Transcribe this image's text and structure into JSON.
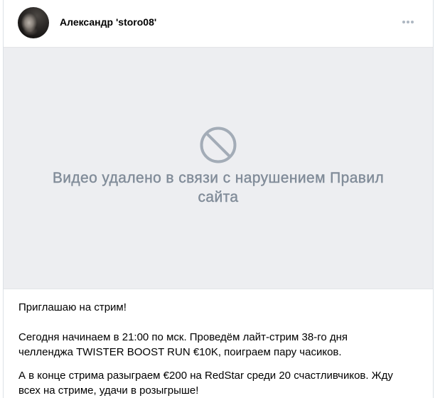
{
  "post": {
    "author": {
      "name": "Александр 'storo08'"
    },
    "menu_icon": "more-horizontal-icon",
    "video": {
      "status_icon": "blocked-icon",
      "message": "Видео удалено в связи с нарушением Правил сайта"
    },
    "text": {
      "paragraphs": [
        {
          "lines": [
            "Приглашаю на стрим!"
          ]
        },
        {
          "lines": [
            "Сегодня начинаем в 21:00 по мск. Проведём лайт-стрим 38-го дня",
            "челленджа TWISTER BOOST RUN €10K, поиграем пару часиков."
          ]
        },
        {
          "lines": [
            "А в конце стрима разыграем €200 на RedStar среди 20 счастливчиков. Жду",
            "всех на стриме, удачи в розыгрыше!"
          ]
        }
      ]
    }
  },
  "colors": {
    "card_border": "#dce1e6",
    "placeholder_background": "#edeef1",
    "placeholder_divider": "#e3e5e8",
    "placeholder_icon": "#a3acb7",
    "placeholder_text": "#818c99",
    "menu_icon": "#aeb7c2",
    "author_name": "#000000",
    "post_text": "#000000"
  }
}
